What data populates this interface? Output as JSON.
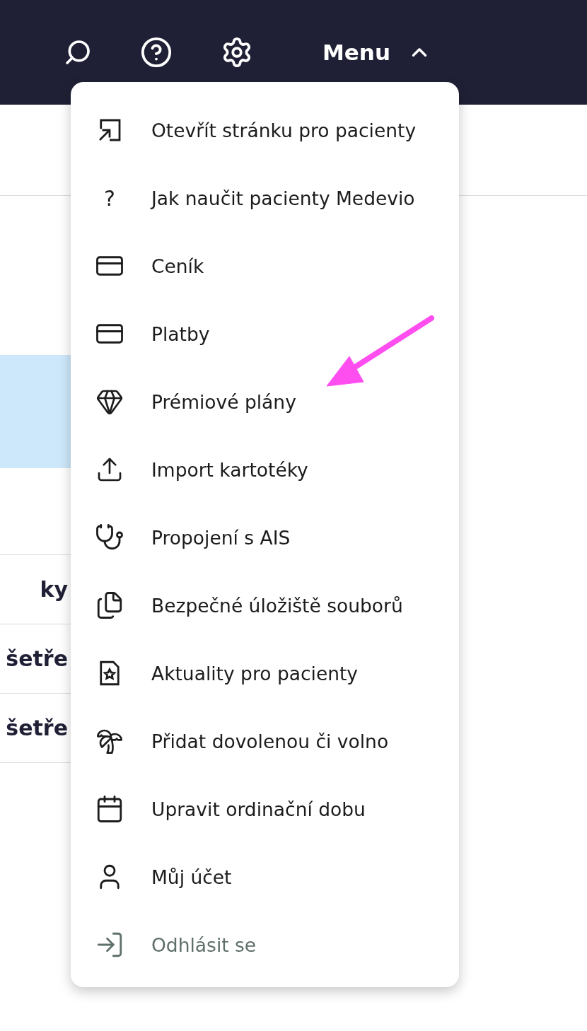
{
  "top_bar": {
    "menu_label": "Menu",
    "expanded": true
  },
  "background_list": [
    {
      "text": "ky"
    },
    {
      "text": "šetře"
    },
    {
      "text": "šetře"
    }
  ],
  "menu": [
    {
      "label": "Otevřít stránku pro pacienty",
      "kind": "link"
    },
    {
      "label": "Jak naučit pacienty Medevio",
      "kind": "glyph",
      "glyph": "?"
    },
    {
      "label": "Ceník",
      "kind": "link"
    },
    {
      "label": "Platby",
      "kind": "link"
    },
    {
      "label": "Prémiové plány",
      "kind": "link"
    },
    {
      "label": "Import kartotéky",
      "kind": "link"
    },
    {
      "label": "Propojení s AIS",
      "kind": "link"
    },
    {
      "label": "Bezpečné úložiště souborů",
      "kind": "link"
    },
    {
      "label": "Aktuality pro pacienty",
      "kind": "link"
    },
    {
      "label": "Přidat dovolenou či volno",
      "kind": "link"
    },
    {
      "label": "Upravit ordinační dobu",
      "kind": "link"
    },
    {
      "label": "Můj účet",
      "kind": "link"
    },
    {
      "label": "Odhlásit se",
      "kind": "secondary"
    }
  ]
}
